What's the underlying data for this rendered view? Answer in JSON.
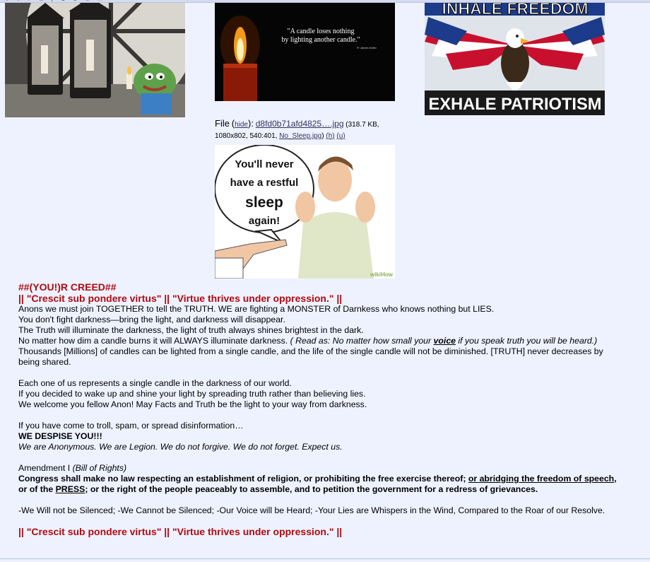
{
  "toolbar": {
    "icons": [
      "refresh-icon",
      "back-icon",
      "forward-icon",
      "home-icon",
      "search-icon",
      "bookmark-icon",
      "settings-icon",
      "user-icon",
      "star-icon",
      "menu-icon"
    ]
  },
  "images": {
    "candle_quote": {
      "quote_line1": "\"A candle loses nothing",
      "quote_line2": "by lighting another candle.\"",
      "attribution": "Fr James Keller"
    },
    "eagle": {
      "top_text": "INHALE FREEDOM",
      "bottom_text": "EXHALE PATRIOTISM"
    },
    "sleep": {
      "bubble_line1": "You'll never",
      "bubble_line2": "have a restful",
      "bubble_line3": "sleep",
      "bubble_line4": "again!",
      "watermark": "wikiHow"
    }
  },
  "file_info": {
    "label": "File",
    "hide": "hide",
    "filename": "d8fd0b71afd4825….jpg",
    "meta": "(318.7 KB, 1080x802, 540:401,",
    "original_name": "No_Sleep.jpg",
    "h": "(h)",
    "u": "(u)"
  },
  "post": {
    "title1": "##(YOU!)R CREED##",
    "title2": "|| \"Crescit sub pondere virtus\" || \"Virtue thrives under oppression.\" ||",
    "line1": "Anons we must join TOGETHER to tell the TRUTH. WE are fighting a MONSTER of Darnkess who knows nothing but LIES.",
    "line2": "You don't fight darkness—bring the light, and darkness will disappear.",
    "line3": "The Truth will illuminate the darkness, the light of truth always shines brightest in the dark.",
    "line4a": "No matter how dim a candle burns it will ALWAYS illuminate darkness. ",
    "line4b": "( Read as: No matter how small your ",
    "line4c": "voice",
    "line4d": " if you speak truth you will be heard.)",
    "line5": "Thousands [Millions] of candles can be lighted from a single candle, and the life of the single candle will not be diminished. [TRUTH] never decreases by being shared.",
    "line6": "Each one of us represents a single candle in the darkness of our world.",
    "line7": "If you decided to wake up and shine your light by spreading truth rather than believing lies.",
    "line8": "We welcome you fellow Anon! May Facts and Truth be the light to your way from darkness.",
    "line9": "If you have come to troll, spam, or spread disinformation…",
    "line10": "WE DESPISE YOU!!!",
    "line11": "We are Anonymous. We are Legion. We do not forgive. We do not forget. Expect us.",
    "amend_a": "Amendment I ",
    "amend_b": "(Bill of Rights)",
    "cong_a": "Congress shall make no law respecting an establishment of religion, or prohibiting the free exercise thereof; ",
    "cong_b": "or abridging the freedom of speech",
    "cong_c": ", or of the ",
    "cong_d": "PRESS",
    "cong_e": "; or the right of the people peaceably to assemble, and to petition the government for a redress of grievances.",
    "silenced": "-We Will not be Silenced;  -We Cannot be Silenced;  -Our Voice will be Heard;   -Your Lies are Whispers in the Wind, Compared to the Roar of our Resolve.",
    "title3": "|| \"Crescit sub pondere virtus\" || \"Virtue thrives under oppression.\" ||"
  }
}
